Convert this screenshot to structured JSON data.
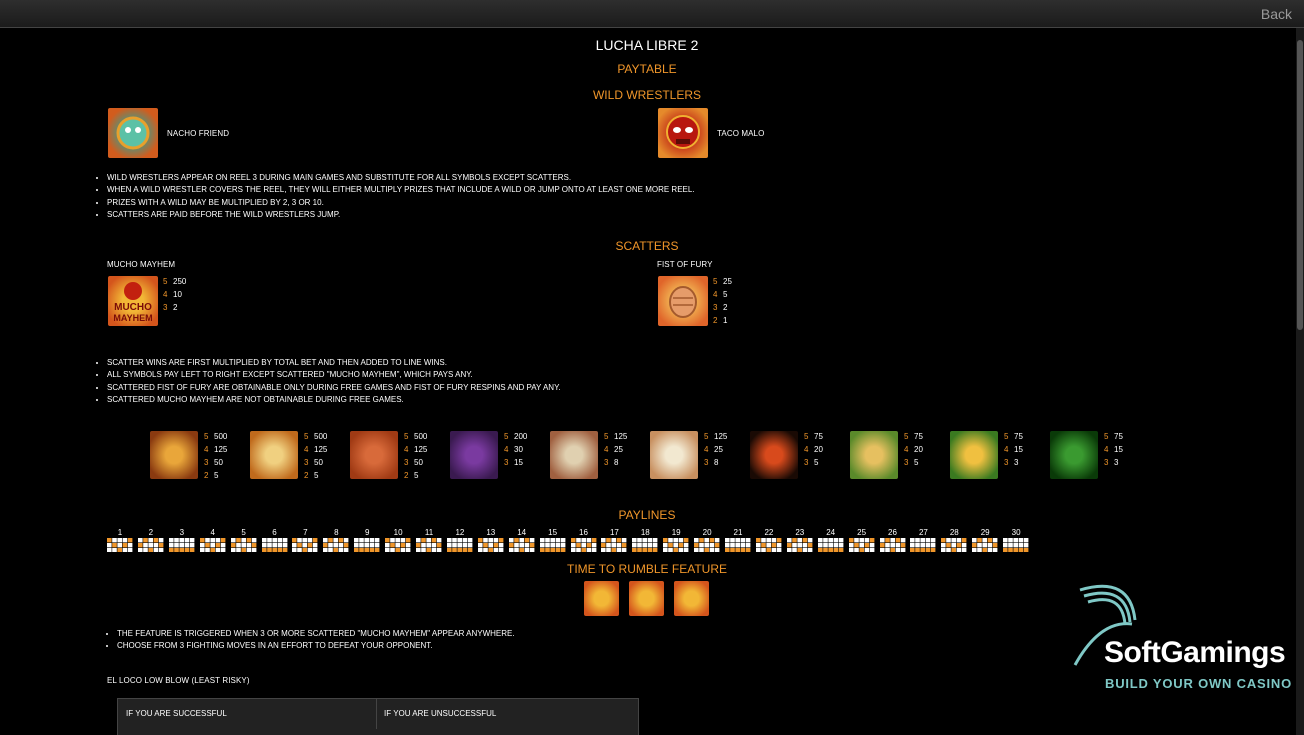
{
  "header": {
    "back_label": "Back"
  },
  "title": "LUCHA LIBRE 2",
  "paytable_label": "PAYTABLE",
  "wild": {
    "heading": "WILD WRESTLERS",
    "symbols": [
      {
        "name": "NACHO FRIEND",
        "icon": "nacho-friend-symbol"
      },
      {
        "name": "TACO MALO",
        "icon": "taco-malo-symbol"
      }
    ],
    "rules": [
      "WILD WRESTLERS APPEAR ON REEL 3 DURING MAIN GAMES AND SUBSTITUTE FOR ALL SYMBOLS EXCEPT SCATTERS.",
      "WHEN A WILD WRESTLER COVERS THE REEL, THEY WILL EITHER MULTIPLY PRIZES THAT INCLUDE A WILD OR JUMP ONTO AT LEAST ONE MORE REEL.",
      "PRIZES WITH A WILD MAY BE MULTIPLIED BY 2, 3 OR 10.",
      "SCATTERS ARE PAID BEFORE THE WILD WRESTLERS JUMP."
    ]
  },
  "scatters": {
    "heading": "SCATTERS",
    "items": [
      {
        "name": "MUCHO MAYHEM",
        "pays": [
          [
            "5",
            "250"
          ],
          [
            "4",
            "10"
          ],
          [
            "3",
            "2"
          ]
        ]
      },
      {
        "name": "FIST OF FURY",
        "pays": [
          [
            "5",
            "25"
          ],
          [
            "4",
            "5"
          ],
          [
            "3",
            "2"
          ],
          [
            "2",
            "1"
          ]
        ]
      }
    ],
    "rules": [
      "SCATTER WINS ARE FIRST MULTIPLIED BY TOTAL BET AND THEN ADDED TO LINE WINS.",
      "ALL SYMBOLS PAY LEFT TO RIGHT EXCEPT SCATTERED \"MUCHO MAYHEM\", WHICH PAYS ANY.",
      "SCATTERED FIST OF FURY ARE OBTAINABLE ONLY DURING FREE GAMES AND FIST OF FURY RESPINS AND PAY ANY.",
      "SCATTERED MUCHO MAYHEM ARE NOT OBTAINABLE DURING FREE GAMES."
    ]
  },
  "symbols": [
    {
      "icon": "gold-belt-symbol",
      "pays": [
        [
          "5",
          "500"
        ],
        [
          "4",
          "125"
        ],
        [
          "3",
          "50"
        ],
        [
          "2",
          "5"
        ]
      ]
    },
    {
      "icon": "trophy-symbol",
      "pays": [
        [
          "5",
          "500"
        ],
        [
          "4",
          "125"
        ],
        [
          "3",
          "50"
        ],
        [
          "2",
          "5"
        ]
      ]
    },
    {
      "icon": "referee-symbol",
      "pays": [
        [
          "5",
          "500"
        ],
        [
          "4",
          "125"
        ],
        [
          "3",
          "50"
        ],
        [
          "2",
          "5"
        ]
      ]
    },
    {
      "icon": "luchador-girl-symbol",
      "pays": [
        [
          "5",
          "200"
        ],
        [
          "4",
          "30"
        ],
        [
          "3",
          "15"
        ]
      ]
    },
    {
      "icon": "cards-symbol",
      "pays": [
        [
          "5",
          "125"
        ],
        [
          "4",
          "25"
        ],
        [
          "3",
          "8"
        ]
      ]
    },
    {
      "icon": "poster-symbol",
      "pays": [
        [
          "5",
          "125"
        ],
        [
          "4",
          "25"
        ],
        [
          "3",
          "8"
        ]
      ]
    },
    {
      "icon": "hot-sauce-symbol",
      "pays": [
        [
          "5",
          "75"
        ],
        [
          "4",
          "20"
        ],
        [
          "3",
          "5"
        ]
      ]
    },
    {
      "icon": "taco-symbol",
      "pays": [
        [
          "5",
          "75"
        ],
        [
          "4",
          "20"
        ],
        [
          "3",
          "5"
        ]
      ]
    },
    {
      "icon": "nacho-chip-symbol",
      "pays": [
        [
          "5",
          "75"
        ],
        [
          "4",
          "15"
        ],
        [
          "3",
          "3"
        ]
      ]
    },
    {
      "icon": "jalapeno-symbol",
      "pays": [
        [
          "5",
          "75"
        ],
        [
          "4",
          "15"
        ],
        [
          "3",
          "3"
        ]
      ]
    }
  ],
  "paylines": {
    "heading": "PAYLINES",
    "numbers": [
      "1",
      "2",
      "3",
      "4",
      "5",
      "6",
      "7",
      "8",
      "9",
      "10",
      "11",
      "12",
      "13",
      "14",
      "15",
      "16",
      "17",
      "18",
      "19",
      "20",
      "21",
      "22",
      "23",
      "24",
      "25",
      "26",
      "27",
      "28",
      "29",
      "30"
    ]
  },
  "feature": {
    "heading": "TIME TO RUMBLE FEATURE",
    "rules": [
      "THE FEATURE IS TRIGGERED WHEN 3 OR MORE SCATTERED \"MUCHO MAYHEM\" APPEAR ANYWHERE.",
      "CHOOSE FROM 3 FIGHTING MOVES IN AN EFFORT TO DEFEAT YOUR OPPONENT."
    ],
    "move_title": "EL LOCO LOW BLOW (LEAST RISKY)",
    "table_headers": [
      "IF YOU ARE SUCCESSFUL",
      "IF YOU ARE UNSUCCESSFUL"
    ]
  },
  "watermark": {
    "brand": "SoftGamings",
    "tagline": "BUILD YOUR OWN CASINO"
  },
  "colors": {
    "accent": "#f0962a",
    "background": "#000000",
    "brand_teal": "#7fc8c6"
  }
}
